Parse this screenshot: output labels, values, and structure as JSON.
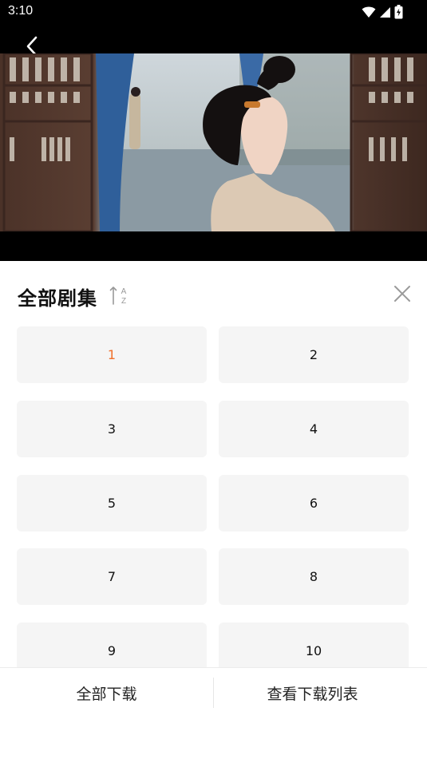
{
  "status_bar": {
    "time": "3:10",
    "icons": [
      "wifi-icon",
      "signal-icon",
      "battery-charging-icon"
    ]
  },
  "video": {
    "back_icon": "chevron-left-icon"
  },
  "sheet": {
    "title": "全部剧集",
    "sort_icon": "sort-a-z-icon",
    "sort_letters": [
      "A",
      "Z"
    ],
    "close_icon": "close-icon",
    "accent_color": "#f0702b",
    "episodes": [
      {
        "label": "1",
        "active": true
      },
      {
        "label": "2",
        "active": false
      },
      {
        "label": "3",
        "active": false
      },
      {
        "label": "4",
        "active": false
      },
      {
        "label": "5",
        "active": false
      },
      {
        "label": "6",
        "active": false
      },
      {
        "label": "7",
        "active": false
      },
      {
        "label": "8",
        "active": false
      },
      {
        "label": "9",
        "active": false
      },
      {
        "label": "10",
        "active": false
      }
    ]
  },
  "bottom_bar": {
    "download_all": "全部下载",
    "view_downloads": "查看下载列表"
  }
}
